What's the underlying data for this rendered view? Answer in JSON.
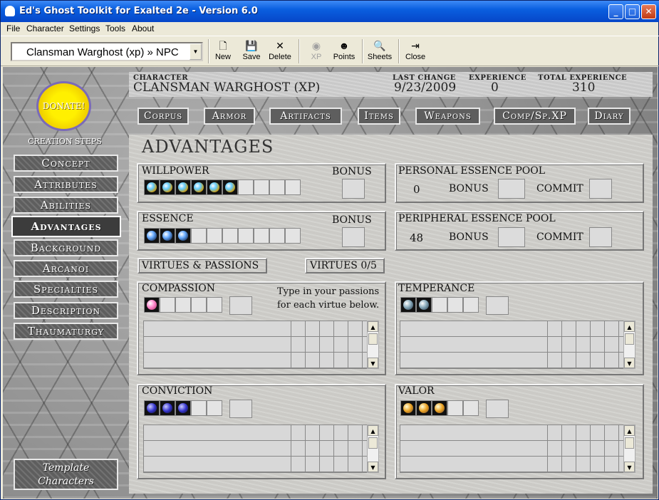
{
  "window": {
    "title": "Ed's Ghost Toolkit for Exalted 2e - Version 6.0",
    "min": "_",
    "max": "□",
    "close": "✕"
  },
  "menu": [
    "File",
    "Character",
    "Settings",
    "Tools",
    "About"
  ],
  "toolbar": {
    "character_select": "Clansman Warghost (xp) » NPC",
    "buttons": [
      {
        "label": "New",
        "icon": "new-icon"
      },
      {
        "label": "Save",
        "icon": "save-icon"
      },
      {
        "label": "Delete",
        "icon": "delete-icon"
      },
      {
        "label": "XP",
        "icon": "xp-icon",
        "disabled": true
      },
      {
        "label": "Points",
        "icon": "points-icon"
      },
      {
        "label": "Sheets",
        "icon": "sheets-icon"
      },
      {
        "label": "Close",
        "icon": "close-door-icon"
      }
    ]
  },
  "sidebar": {
    "donate": "DONATE!",
    "creation_steps": "CREATION STEPS",
    "steps": [
      "Concept",
      "Attributes",
      "Abilities",
      "Advantages",
      "Background",
      "Arcanoi",
      "Specialties",
      "Description",
      "Thaumaturgy"
    ],
    "active": "Advantages",
    "template_line1": "Template",
    "template_line2": "Characters"
  },
  "header": {
    "character_label": "CHARACTER",
    "character": "CLANSMAN WARGHOST (XP)",
    "last_change_label": "LAST CHANGE",
    "last_change": "9/23/2009",
    "experience_label": "EXPERIENCE",
    "experience": "0",
    "total_label": "TOTAL EXPERIENCE",
    "total": "310"
  },
  "nav": [
    "Corpus",
    "Armor",
    "Artifacts",
    "Items",
    "Weapons",
    "Comp/Sp.XP",
    "Diary"
  ],
  "panel": {
    "title": "ADVANTAGES",
    "willpower": {
      "label": "WILLPOWER",
      "bonus_label": "BONUS",
      "dots": 6,
      "max": 10
    },
    "essence": {
      "label": "ESSENCE",
      "bonus_label": "BONUS",
      "dots": 3,
      "max": 10
    },
    "personal": {
      "label": "PERSONAL ESSENCE POOL",
      "value": "0",
      "bonus_label": "BONUS",
      "commit_label": "COMMIT"
    },
    "peripheral": {
      "label": "PERIPHERAL ESSENCE POOL",
      "value": "48",
      "bonus_label": "BONUS",
      "commit_label": "COMMIT"
    },
    "virtues_tab": "VIRTUES & PASSIONS",
    "virtues_count": "VIRTUES  0/5",
    "hint_line1": "Type in your passions",
    "hint_line2": "for each virtue below.",
    "compassion": {
      "label": "COMPASSION",
      "dots": 1,
      "max": 5
    },
    "temperance": {
      "label": "TEMPERANCE",
      "dots": 2,
      "max": 5
    },
    "conviction": {
      "label": "CONVICTION",
      "dots": 3,
      "max": 5
    },
    "valor": {
      "label": "VALOR",
      "dots": 3,
      "max": 5
    }
  }
}
